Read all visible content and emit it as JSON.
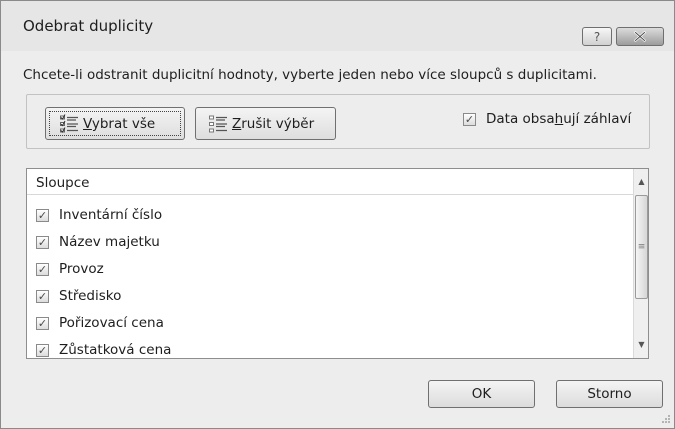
{
  "dialog": {
    "title": "Odebrat duplicity",
    "help_label": "?",
    "instruction": "Chcete-li odstranit duplicitní hodnoty, vyberte jeden nebo více sloupců s duplicitami.",
    "select_all": {
      "prefix": "",
      "accel": "V",
      "rest": "ybrat vše",
      "icon": "select-all-icon"
    },
    "unselect_all": {
      "prefix": "",
      "accel": "Z",
      "rest": "rušit výběr",
      "icon": "unselect-all-icon"
    },
    "headers_checkbox": {
      "prefix": "Data obsa",
      "accel": "h",
      "rest": "ují záhlaví",
      "checked": true
    },
    "columns": {
      "header": "Sloupce",
      "items": [
        {
          "label": "Inventární číslo",
          "checked": true
        },
        {
          "label": "Název majetku",
          "checked": true
        },
        {
          "label": "Provoz",
          "checked": true
        },
        {
          "label": "Středisko",
          "checked": true
        },
        {
          "label": "Pořizovací cena",
          "checked": true
        },
        {
          "label": "Zůstatková cena",
          "checked": true
        }
      ]
    },
    "ok_label": "OK",
    "cancel_label": "Storno"
  }
}
